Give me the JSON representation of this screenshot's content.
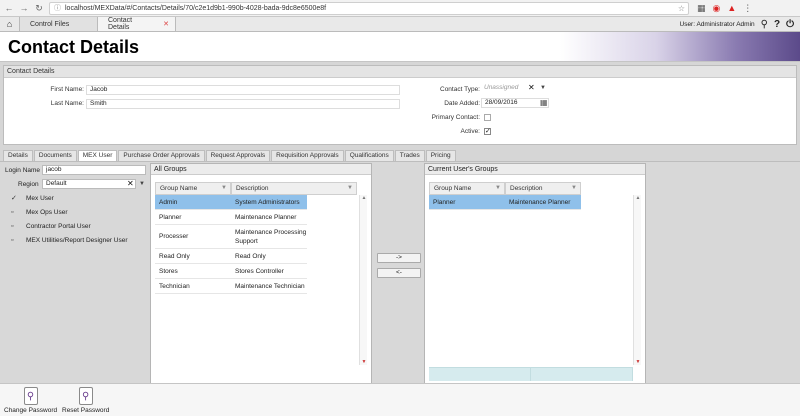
{
  "browser": {
    "url": "localhost/MEXData/#/Contacts/Details/70/c2e1d9b1-990b-4028-bada-9dc8e6500e8f"
  },
  "app_tabs": [
    {
      "label": "Control Files"
    },
    {
      "label": "Contact Details"
    }
  ],
  "user_text": "User: Administrator Admin",
  "page_title": "Contact Details",
  "details": {
    "panel_title": "Contact Details",
    "first_name_label": "First Name:",
    "first_name_value": "Jacob",
    "last_name_label": "Last Name:",
    "last_name_value": "Smith",
    "contact_type_label": "Contact Type:",
    "contact_type_value": "Unassigned",
    "date_added_label": "Date Added:",
    "date_added_value": "28/09/2016",
    "primary_contact_label": "Primary Contact:",
    "active_label": "Active:",
    "primary_contact_checked": false,
    "active_checked": true
  },
  "subtabs": [
    "Details",
    "Documents",
    "MEX User",
    "Purchase Order Approvals",
    "Request Approvals",
    "Requisition Approvals",
    "Qualifications",
    "Trades",
    "Pricing"
  ],
  "mex_user": {
    "login_label": "Login Name",
    "login_value": "jacob",
    "region_label": "Region",
    "region_value": "Default",
    "roles": [
      {
        "label": "Mex User",
        "checked": true
      },
      {
        "label": "Mex Ops User",
        "checked": false
      },
      {
        "label": "Contractor Portal User",
        "checked": false
      },
      {
        "label": "MEX Utilities/Report Designer User",
        "checked": false
      }
    ]
  },
  "all_groups": {
    "title": "All Groups",
    "columns": [
      "Group Name",
      "Description"
    ],
    "rows": [
      {
        "name": "Admin",
        "desc": "System Administrators",
        "selected": true
      },
      {
        "name": "Planner",
        "desc": "Maintenance Planner",
        "selected": false
      },
      {
        "name": "Processer",
        "desc": "Maintenance Processing Support",
        "selected": false
      },
      {
        "name": "Read Only",
        "desc": "Read Only",
        "selected": false
      },
      {
        "name": "Stores",
        "desc": "Stores Controller",
        "selected": false
      },
      {
        "name": "Technician",
        "desc": "Maintenance Technician",
        "selected": false
      }
    ]
  },
  "move_buttons": {
    "add": "->",
    "remove": "<-"
  },
  "current_groups": {
    "title": "Current User's Groups",
    "columns": [
      "Group Name",
      "Description"
    ],
    "rows": [
      {
        "name": "Planner",
        "desc": "Maintenance Planner",
        "selected": true
      }
    ]
  },
  "toolbar": {
    "change_password": "Change Password",
    "reset_password": "Reset Password"
  }
}
